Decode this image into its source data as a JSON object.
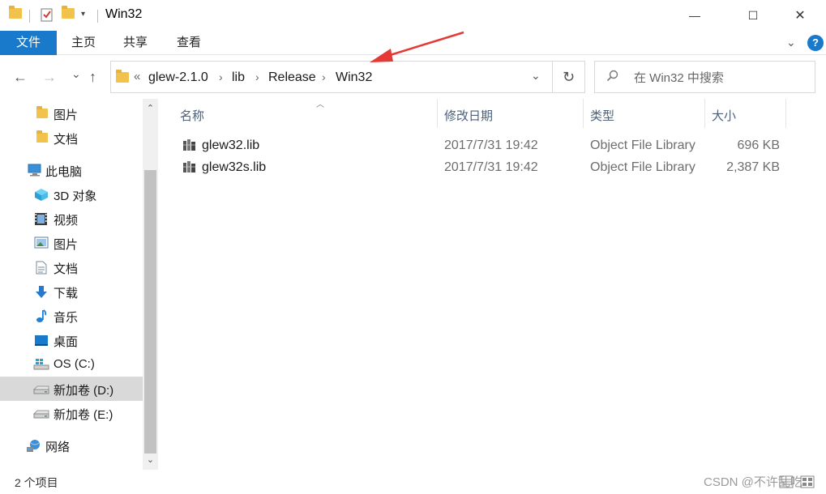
{
  "window": {
    "title": "Win32",
    "controls": {
      "minimize": "—",
      "maximize": "☐",
      "close": "✕"
    }
  },
  "ribbon": {
    "tabs": [
      "文件",
      "主页",
      "共享",
      "查看"
    ],
    "expand_icon": "chevron-down-icon",
    "help_label": "?"
  },
  "navigation": {
    "back": "←",
    "forward": "→",
    "recent": "⌄",
    "up": "↑",
    "breadcrumb_prefix": "«",
    "breadcrumb": [
      "glew-2.1.0",
      "lib",
      "Release",
      "Win32"
    ],
    "separator": "›",
    "refresh": "↻"
  },
  "search": {
    "placeholder": "在 Win32 中搜索"
  },
  "sidebar": {
    "items": [
      {
        "label": "图片",
        "icon": "folder-icon"
      },
      {
        "label": "文档",
        "icon": "folder-icon"
      },
      {
        "label": "此电脑",
        "icon": "computer-icon"
      },
      {
        "label": "3D 对象",
        "icon": "3d-objects-icon"
      },
      {
        "label": "视频",
        "icon": "video-icon"
      },
      {
        "label": "图片",
        "icon": "pictures-icon"
      },
      {
        "label": "文档",
        "icon": "documents-icon"
      },
      {
        "label": "下载",
        "icon": "download-icon"
      },
      {
        "label": "音乐",
        "icon": "music-icon"
      },
      {
        "label": "桌面",
        "icon": "desktop-icon"
      },
      {
        "label": "OS (C:)",
        "icon": "windows-drive-icon"
      },
      {
        "label": "新加卷 (D:)",
        "icon": "drive-icon",
        "selected": true
      },
      {
        "label": "新加卷 (E:)",
        "icon": "drive-icon"
      },
      {
        "label": "网络",
        "icon": "network-icon"
      }
    ]
  },
  "files": {
    "columns": [
      "名称",
      "修改日期",
      "类型",
      "大小"
    ],
    "rows": [
      {
        "name": "glew32.lib",
        "date": "2017/7/31 19:42",
        "type": "Object File Library",
        "size": "696 KB"
      },
      {
        "name": "glew32s.lib",
        "date": "2017/7/31 19:42",
        "type": "Object File Library",
        "size": "2,387 KB"
      }
    ]
  },
  "status": {
    "item_count": "2 个项目",
    "watermark": "CSDN @不许乱吃"
  },
  "colors": {
    "accent": "#1979ca",
    "folder": "#f1c24c",
    "annotation_arrow": "#e53935",
    "selected": "#d9d9d9"
  }
}
